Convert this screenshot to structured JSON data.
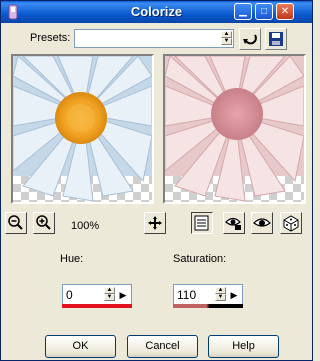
{
  "window": {
    "title": "Colorize"
  },
  "presets": {
    "label": "Presets:",
    "value": ""
  },
  "zoom": {
    "level": "100%"
  },
  "hue": {
    "label": "Hue:",
    "value": "0",
    "bar_color": "#e0141e"
  },
  "saturation": {
    "label": "Saturation:",
    "value": "110",
    "bar_colors": [
      "#c06060",
      "#000000"
    ]
  },
  "buttons": {
    "ok": "OK",
    "cancel": "Cancel",
    "help": "Help"
  }
}
